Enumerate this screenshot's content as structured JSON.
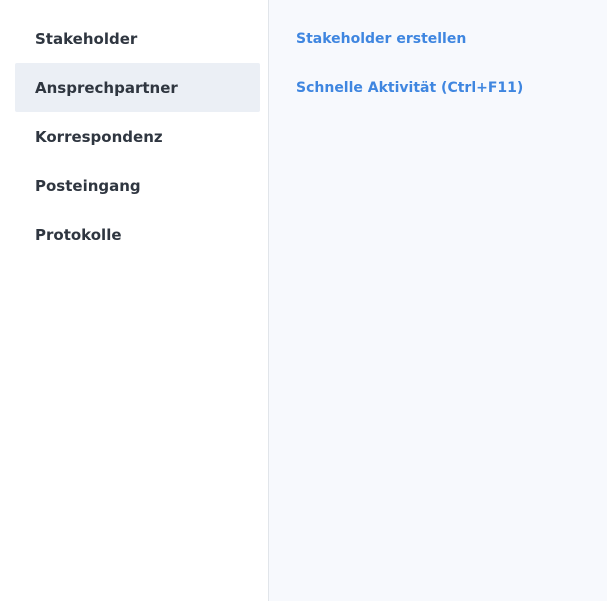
{
  "sidebar": {
    "items": [
      {
        "label": "Stakeholder",
        "active": false
      },
      {
        "label": "Ansprechpartner",
        "active": true
      },
      {
        "label": "Korrespondenz",
        "active": false
      },
      {
        "label": "Posteingang",
        "active": false
      },
      {
        "label": "Protokolle",
        "active": false
      }
    ]
  },
  "main": {
    "actions": [
      {
        "label": "Stakeholder erstellen"
      },
      {
        "label": "Schnelle Aktivität (Ctrl+F11)"
      }
    ]
  },
  "colors": {
    "link": "#3f86e0",
    "active_bg": "#ebeff5",
    "panel_bg": "#f7f9fd",
    "text": "#2f3640"
  }
}
